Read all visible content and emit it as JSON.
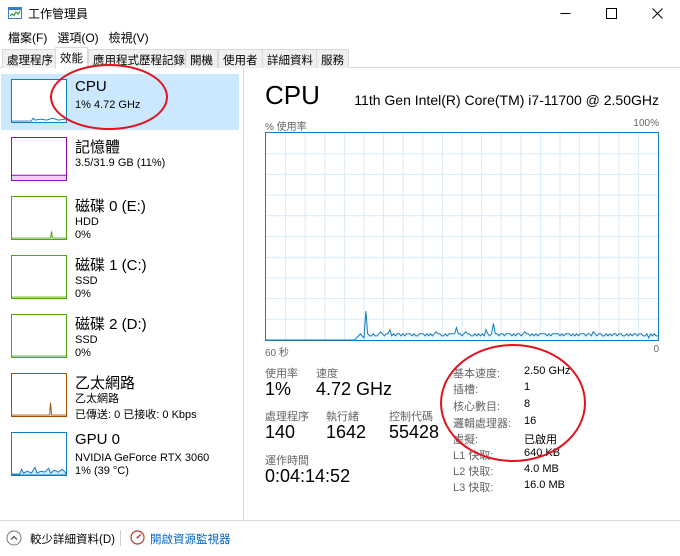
{
  "window": {
    "title": "工作管理員"
  },
  "menu": [
    "檔案(F)",
    "選項(O)",
    "檢視(V)"
  ],
  "tabs": [
    "處理程序",
    "效能",
    "應用程式歷程記錄",
    "開機",
    "使用者",
    "詳細資料",
    "服務"
  ],
  "active_tab": "效能",
  "sidebar": [
    {
      "title": "CPU",
      "line1": "1%  4.72 GHz",
      "line2": "",
      "color": "#117dbb"
    },
    {
      "title": "記憶體",
      "line1": "3.5/31.9 GB (11%)",
      "line2": "",
      "color": "#8b12ae"
    },
    {
      "title": "磁碟 0 (E:)",
      "line1": "HDD",
      "line2": "0%",
      "color": "#4da60c"
    },
    {
      "title": "磁碟 1 (C:)",
      "line1": "SSD",
      "line2": "0%",
      "color": "#4da60c"
    },
    {
      "title": "磁碟 2 (D:)",
      "line1": "SSD",
      "line2": "0%",
      "color": "#4da60c"
    },
    {
      "title": "乙太網路",
      "line1": "乙太網路",
      "line2": "已傳送: 0  已接收: 0 Kbps",
      "color": "#a74f01"
    },
    {
      "title": "GPU 0",
      "line1": "NVIDIA GeForce RTX 3060",
      "line2": "1% (39 °C)",
      "color": "#117dbb"
    }
  ],
  "main": {
    "title": "CPU",
    "model": "11th Gen Intel(R) Core(TM) i7-11700 @ 2.50GHz",
    "graph_label_left": "% 使用率",
    "graph_label_right": "100%",
    "graph_time_left": "60 秒",
    "graph_time_right": "0",
    "stats": {
      "usage_label": "使用率",
      "usage_value": "1%",
      "speed_label": "速度",
      "speed_value": "4.72 GHz",
      "processes_label": "處理程序",
      "processes_value": "140",
      "threads_label": "執行緒",
      "threads_value": "1642",
      "handles_label": "控制代碼",
      "handles_value": "55428",
      "uptime_label": "運作時間",
      "uptime_value": "0:04:14:52"
    },
    "specs": [
      {
        "label": "基本速度:",
        "value": "2.50 GHz"
      },
      {
        "label": "插槽:",
        "value": "1"
      },
      {
        "label": "核心數目:",
        "value": "8"
      },
      {
        "label": "邏輯處理器:",
        "value": "16"
      },
      {
        "label": "虛擬:",
        "value": "已啟用"
      },
      {
        "label": "L1 快取:",
        "value": "640 KB"
      },
      {
        "label": "L2 快取:",
        "value": "4.0 MB"
      },
      {
        "label": "L3 快取:",
        "value": "16.0 MB"
      }
    ]
  },
  "footer": {
    "fewer_details": "較少詳細資料(D)",
    "open_resmon": "開啟資源監視器"
  },
  "cpu_history": [
    0,
    0,
    0,
    0,
    0,
    0,
    0,
    0,
    0,
    0,
    0,
    0,
    0,
    0,
    0,
    0,
    0,
    0,
    0,
    0,
    0,
    0,
    0,
    0,
    0,
    0,
    0,
    0,
    0,
    0,
    0,
    0,
    0,
    0,
    0,
    0,
    0,
    0,
    0,
    0,
    0,
    0,
    0,
    0,
    0,
    0,
    0,
    0,
    0,
    1,
    2,
    3,
    2,
    1,
    14,
    3,
    2,
    2,
    3,
    2,
    2,
    3,
    4,
    3,
    2,
    3,
    3,
    5,
    2,
    3,
    2,
    3,
    3,
    2,
    3,
    2,
    3,
    3,
    3,
    2,
    3,
    2,
    2,
    3,
    3,
    3,
    2,
    3,
    2,
    3,
    2,
    3,
    4,
    3,
    3,
    2,
    2,
    3,
    2,
    3,
    3,
    3,
    3,
    6,
    3,
    3,
    2,
    3,
    4,
    3,
    3,
    2,
    2,
    3,
    2,
    3,
    2,
    3,
    2,
    5,
    3,
    2,
    3,
    8,
    3,
    3,
    2,
    3,
    3,
    2,
    3,
    3,
    3,
    2,
    3,
    2,
    3,
    3,
    2,
    3,
    4,
    3,
    3,
    2,
    3,
    2,
    3,
    2,
    3,
    3,
    3,
    3,
    2,
    3,
    2,
    3,
    3,
    3,
    3,
    2,
    3,
    2,
    3,
    3,
    3,
    2,
    3,
    2,
    3,
    2,
    3,
    3,
    3,
    2,
    3,
    3,
    2,
    4,
    3,
    2,
    3,
    3,
    2,
    2,
    3,
    2,
    3,
    2,
    3,
    3,
    2,
    3,
    3,
    2,
    2,
    3,
    2,
    3,
    2,
    3,
    3,
    2,
    3,
    3,
    2,
    2,
    3,
    1,
    3,
    2,
    3,
    2,
    2
  ]
}
